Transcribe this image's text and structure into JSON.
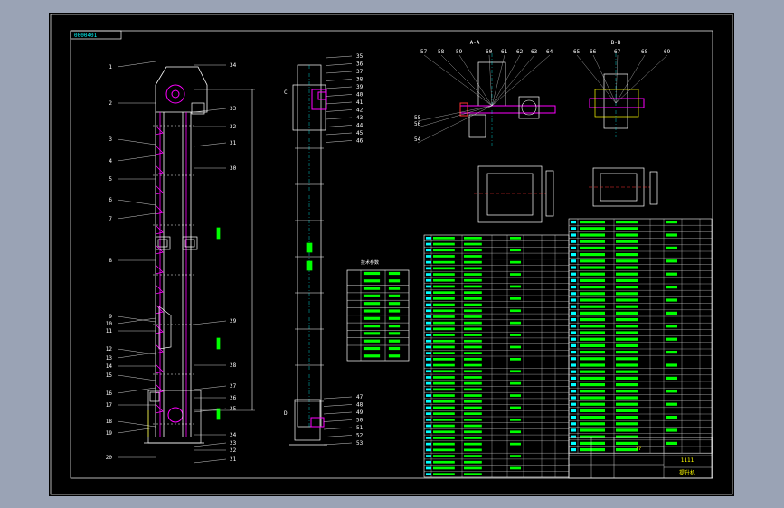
{
  "drawing": {
    "frame_tag": "0000401",
    "title_block_code": "1111",
    "title_block_name": "提升机",
    "title_block_mark": "??"
  },
  "views": {
    "main_left_part_numbers": [
      "1",
      "2",
      "3",
      "4",
      "5",
      "6",
      "7",
      "8",
      "9",
      "10",
      "11",
      "12",
      "13",
      "14",
      "15",
      "16",
      "17",
      "18",
      "19",
      "20"
    ],
    "main_right_part_numbers": [
      "34",
      "33",
      "32",
      "31",
      "30",
      "29",
      "28",
      "27",
      "26",
      "25",
      "24",
      "23",
      "22",
      "21"
    ],
    "side_part_numbers_top": [
      "35",
      "36",
      "37",
      "38",
      "39",
      "40",
      "41",
      "42",
      "43",
      "44",
      "45",
      "46"
    ],
    "side_part_numbers_bottom": [
      "47",
      "48",
      "49",
      "50",
      "51",
      "52",
      "53"
    ],
    "detail_a_part_numbers": [
      "57",
      "58",
      "59",
      "60",
      "61",
      "62",
      "63",
      "64",
      "55",
      "56",
      "54"
    ],
    "detail_b_part_numbers": [
      "65",
      "66",
      "67",
      "68",
      "69"
    ],
    "section_a_label": "A-A",
    "section_b_label": "B-B",
    "side_view_mark_c": "C",
    "side_view_mark_d": "D",
    "tech_table_title": "技术参数"
  },
  "colors": {
    "frame_bg": "#9aa3b5",
    "sheet_bg": "#000000",
    "border": "#ffffff",
    "cyan": "#00ffff",
    "magenta": "#ff00ff",
    "green": "#00ff00",
    "yellow": "#ffff00",
    "red": "#ff3030",
    "white": "#ffffff"
  }
}
